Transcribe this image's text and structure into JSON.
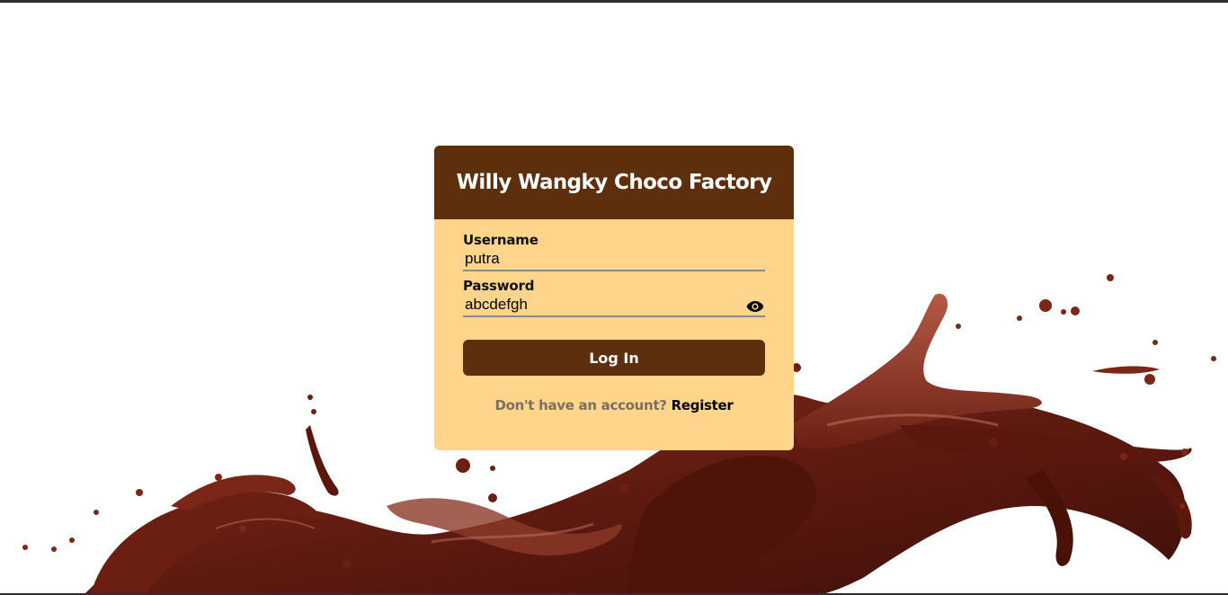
{
  "login": {
    "title": "Willy Wangky Choco Factory",
    "username": {
      "label": "Username",
      "value": "putra"
    },
    "password": {
      "label": "Password",
      "value": "abcdefgh",
      "toggle_icon": "eye-icon"
    },
    "submit_label": "Log In",
    "register_prompt": "Don't have an account?",
    "register_link": "Register"
  },
  "colors": {
    "header": "#5d2f0c",
    "card": "#fed58b",
    "button": "#5d2f0c",
    "chocolate": "#6b1f12"
  }
}
